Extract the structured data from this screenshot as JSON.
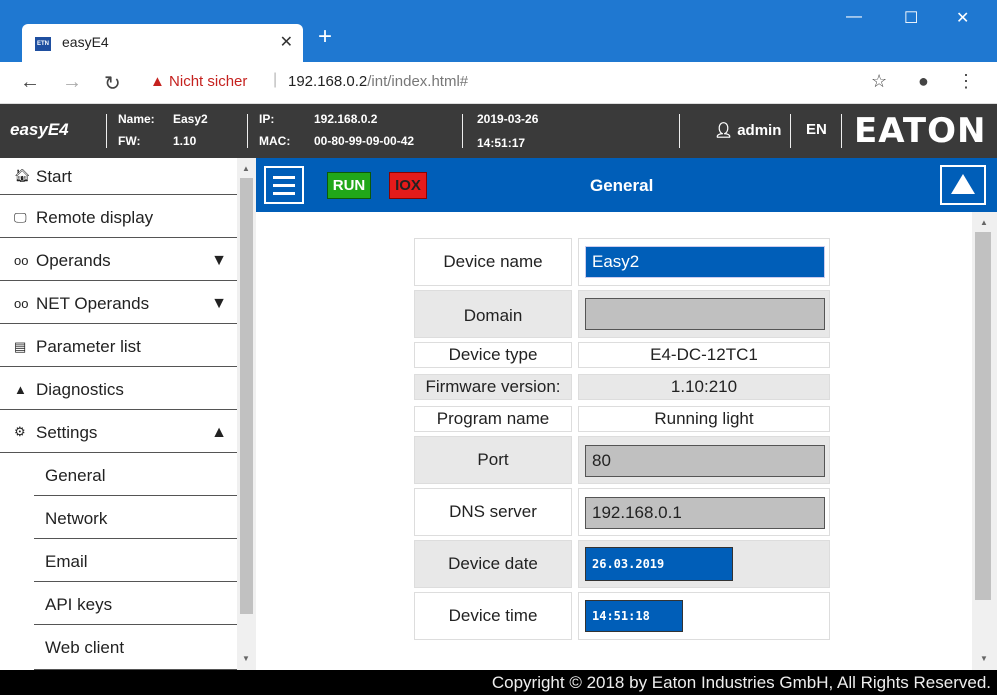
{
  "browser": {
    "tab_title": "easyE4",
    "favicon_text": "ETN",
    "security_label": "Nicht sicher",
    "url_host": "192.168.0.2",
    "url_path": "/int/index.html#"
  },
  "header": {
    "app_name": "easyE4",
    "name_label": "Name:",
    "name_value": "Easy2",
    "fw_label": "FW:",
    "fw_value": "1.10",
    "ip_label": "IP:",
    "ip_value": "192.168.0.2",
    "mac_label": "MAC:",
    "mac_value": "00-80-99-09-00-42",
    "date": "2019-03-26",
    "time": "14:51:17",
    "user": "admin",
    "language": "EN",
    "brand": "EATON"
  },
  "sidebar": {
    "items": [
      {
        "label": "Start",
        "icon": "home-icon"
      },
      {
        "label": "Remote display",
        "icon": "monitor-icon"
      },
      {
        "label": "Operands",
        "icon": "glasses-icon",
        "arrow": "▼"
      },
      {
        "label": "NET Operands",
        "icon": "glasses-icon",
        "arrow": "▼"
      },
      {
        "label": "Parameter list",
        "icon": "list-icon"
      },
      {
        "label": "Diagnostics",
        "icon": "warning-icon"
      },
      {
        "label": "Settings",
        "icon": "gear-icon",
        "arrow": "▲"
      }
    ],
    "sub_items": [
      "General",
      "Network",
      "Email",
      "API keys",
      "Web client"
    ]
  },
  "toolbar": {
    "run_label": "RUN",
    "iox_label": "IOX",
    "title": "General"
  },
  "form": {
    "device_name_label": "Device name",
    "device_name_value": "Easy2",
    "domain_label": "Domain",
    "domain_value": "",
    "device_type_label": "Device type",
    "device_type_value": "E4-DC-12TC1",
    "firmware_label": "Firmware version:",
    "firmware_value": "1.10:210",
    "program_label": "Program name",
    "program_value": "Running light",
    "port_label": "Port",
    "port_value": "80",
    "dns_label": "DNS server",
    "dns_value": "192.168.0.1",
    "date_label": "Device date",
    "date_value": "26.03.2019",
    "time_label": "Device time",
    "time_value": "14:51:18"
  },
  "footer": {
    "copyright": "Copyright © 2018 by Eaton Industries GmbH, All Rights Reserved."
  }
}
